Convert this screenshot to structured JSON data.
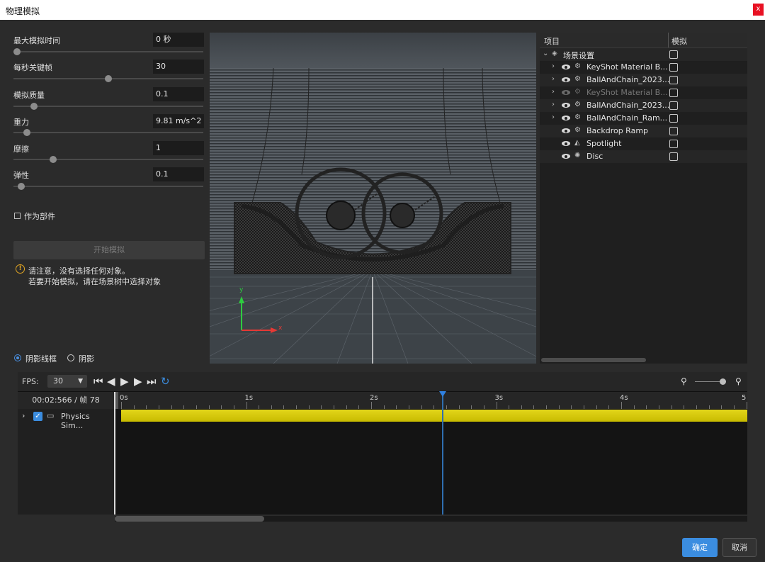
{
  "window": {
    "title": "物理模拟",
    "close_label": "x"
  },
  "params": [
    {
      "label": "最大模拟时间",
      "value": "0 秒",
      "level": 0.02
    },
    {
      "label": "每秒关键帧",
      "value": "30",
      "level": 0.5
    },
    {
      "label": "模拟质量",
      "value": "0.1",
      "level": 0.11
    },
    {
      "label": "重力",
      "value": "9.81 m/s^2",
      "level": 0.07
    },
    {
      "label": "摩擦",
      "value": "1",
      "level": 0.21
    },
    {
      "label": "弹性",
      "value": "0.1",
      "level": 0.04
    }
  ],
  "as_part_label": "作为部件",
  "start_button": "开始模拟",
  "warning": {
    "line1": "请注意，没有选择任何对象。",
    "line2": "若要开始模拟，请在场景树中选择对象"
  },
  "shading": {
    "option1": "阴影线框",
    "option2": "阴影"
  },
  "viewport": {
    "axis_y": "y",
    "axis_x": "x"
  },
  "tree": {
    "col_item": "项目",
    "col_simulate": "模拟",
    "rows": [
      {
        "label": "场景设置",
        "icon": "scene-icon",
        "dim": false
      },
      {
        "label": "KeyShot Material B...",
        "icon": "model-icon",
        "dim": false
      },
      {
        "label": "BallAndChain_2023...",
        "icon": "model-icon",
        "dim": false
      },
      {
        "label": "KeyShot Material B...",
        "icon": "model-icon",
        "dim": true
      },
      {
        "label": "BallAndChain_2023...",
        "icon": "model-icon",
        "dim": false
      },
      {
        "label": "BallAndChain_Ram...",
        "icon": "model-icon",
        "dim": false
      },
      {
        "label": "Backdrop Ramp",
        "icon": "model-icon",
        "dim": false
      },
      {
        "label": "Spotlight",
        "icon": "spotlight-icon",
        "dim": false
      },
      {
        "label": "Disc",
        "icon": "light-icon",
        "dim": false
      }
    ]
  },
  "timeline": {
    "fps_label": "FPS:",
    "fps_value": "30",
    "time_readout": "00:02:566 / 帧 78",
    "track_label": "Physics Sim...",
    "ruler_labels": [
      "0s",
      "1s",
      "2s",
      "3s",
      "4s",
      "5"
    ],
    "playhead_seconds": 2.566,
    "total_seconds": 5
  },
  "buttons": {
    "ok": "确定",
    "cancel": "取消"
  },
  "colors": {
    "accent": "#3b8de0",
    "track": "#e3d61a",
    "warning": "#e5a823"
  }
}
